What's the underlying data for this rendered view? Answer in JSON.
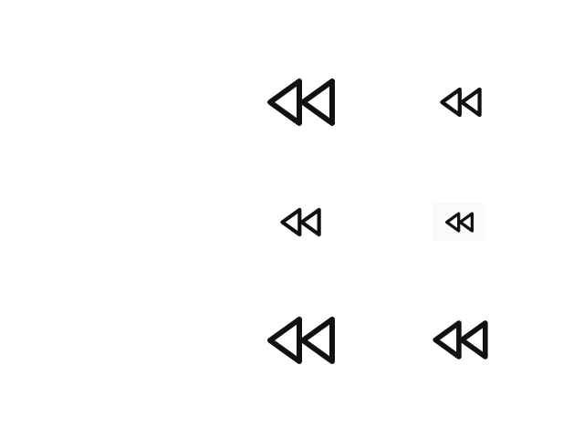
{
  "icons": [
    {
      "id": "i1",
      "name": "rewind-icon",
      "color": "#111111"
    },
    {
      "id": "i2",
      "name": "rewind-icon",
      "color": "#111111"
    },
    {
      "id": "i3",
      "name": "rewind-icon",
      "color": "#111111"
    },
    {
      "id": "i4",
      "name": "rewind-icon",
      "color": "#111111"
    },
    {
      "id": "i5",
      "name": "rewind-icon",
      "color": "#111111"
    },
    {
      "id": "i6",
      "name": "rewind-icon",
      "color": "#111111"
    }
  ],
  "colors": {
    "background": "#ffffff",
    "icon_stroke": "#111111",
    "tile_background": "#fafafa"
  }
}
